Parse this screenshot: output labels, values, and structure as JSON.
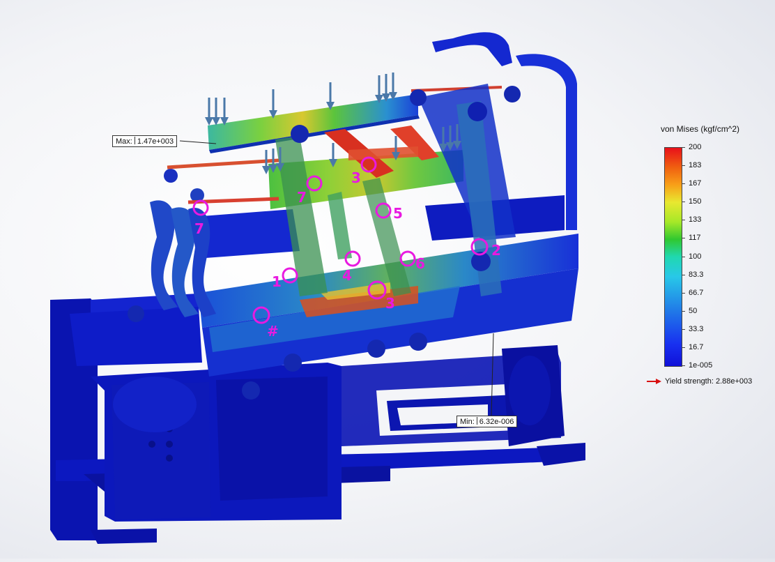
{
  "probes": {
    "max": {
      "label": "Max:",
      "value": "1.47e+003"
    },
    "min": {
      "label": "Min:",
      "value": "6.32e-006"
    }
  },
  "markers": [
    "3",
    "7",
    "7",
    "5",
    "2",
    "6",
    "4",
    "1",
    "3",
    "#"
  ],
  "legend": {
    "title": "von Mises (kgf/cm^2)",
    "ticks": [
      "200",
      "183",
      "167",
      "150",
      "133",
      "117",
      "100",
      "83.3",
      "66.7",
      "50",
      "33.3",
      "16.7",
      "1e-005"
    ],
    "yield_label": "Yield strength: 2.88e+003"
  },
  "colors": {
    "marker": "#e81ae0",
    "structure_blue": "#0a16c8",
    "stress_red": "#e8101a",
    "stress_green": "#5cc43c",
    "background": "#f3f4f7"
  }
}
